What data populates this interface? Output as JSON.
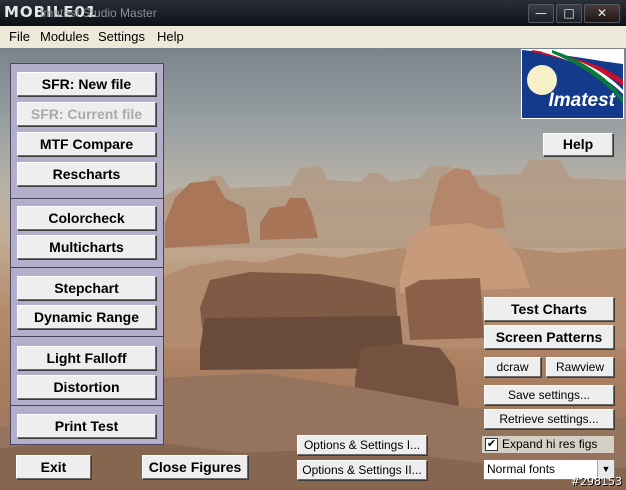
{
  "titlebar": {
    "logo": "MOBILE01",
    "title": "Imatest Studio Master",
    "minimize": "—",
    "maximize": "□",
    "close": "✕"
  },
  "menu": [
    "File",
    "Modules",
    "Settings",
    "Help"
  ],
  "left_panel": {
    "group1": [
      "SFR: New file",
      "SFR: Current file",
      "MTF Compare",
      "Rescharts"
    ],
    "group2": [
      "Colorcheck",
      "Multicharts"
    ],
    "group3": [
      "Stepchart",
      "Dynamic Range"
    ],
    "group4": [
      "Light Falloff",
      "Distortion"
    ],
    "group5": [
      "Print Test"
    ]
  },
  "bottom": {
    "exit": "Exit",
    "close_figures": "Close Figures",
    "options1": "Options & Settings I...",
    "options2": "Options & Settings II..."
  },
  "right_panel": {
    "logo_text": "Imatest",
    "help": "Help",
    "test_charts": "Test Charts",
    "screen_patterns": "Screen Patterns",
    "dcraw": "dcraw",
    "rawview": "Rawview",
    "save_settings": "Save settings...",
    "retrieve_settings": "Retrieve settings...",
    "expand_label": "Expand hi res figs",
    "expand_checked": "✔",
    "font_select": "Normal fonts",
    "font_arrow": "▼"
  },
  "watermark": "#298153"
}
